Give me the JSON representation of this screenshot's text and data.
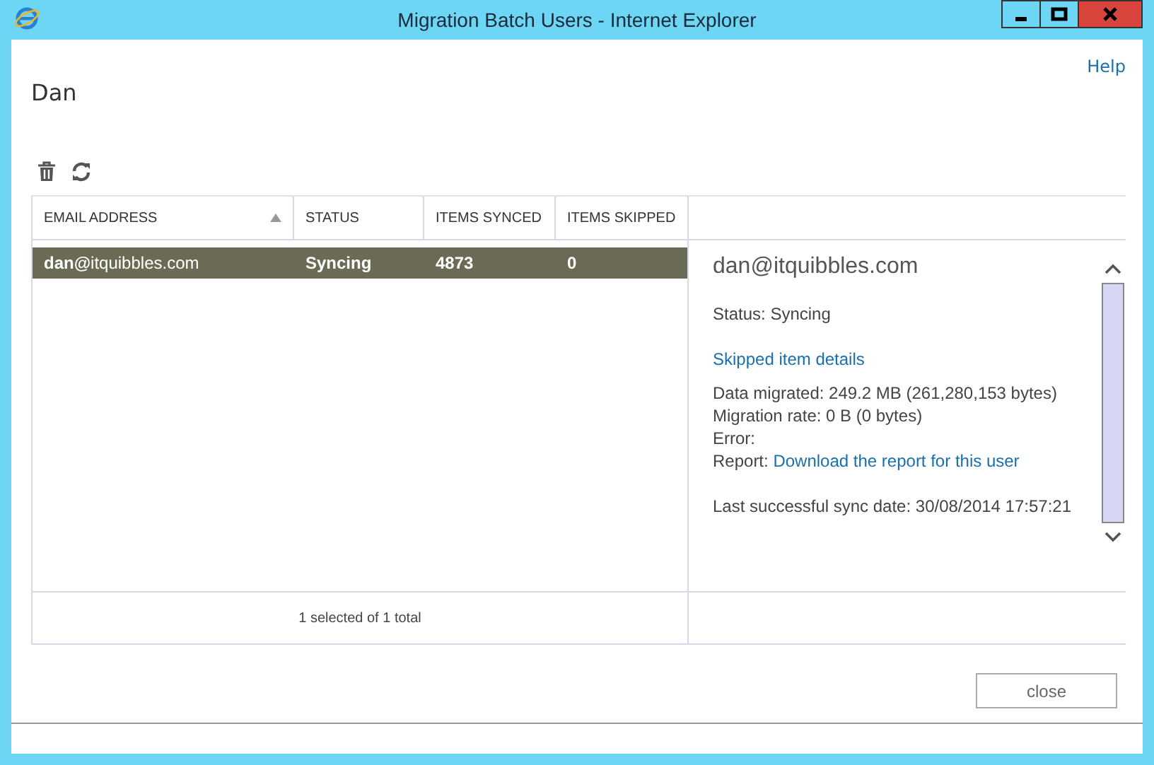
{
  "window": {
    "title": "Migration Batch Users - Internet Explorer"
  },
  "help_link": "Help",
  "page_title": "Dan",
  "table": {
    "columns": [
      {
        "label": "EMAIL ADDRESS",
        "sorted": true
      },
      {
        "label": "STATUS",
        "sorted": false
      },
      {
        "label": "ITEMS SYNCED",
        "sorted": false
      },
      {
        "label": "ITEMS SKIPPED",
        "sorted": false
      }
    ],
    "rows": [
      {
        "selected": true,
        "cells": [
          "**dan@**itquibbles.com",
          "Syncing",
          "4873",
          "0"
        ]
      }
    ],
    "footer": "1 selected of 1 total"
  },
  "details": {
    "title": "dan@itquibbles.com",
    "groups": [
      [
        {
          "kind": "text",
          "text": "Status: Syncing"
        }
      ],
      [
        {
          "kind": "link",
          "text": "Skipped item details"
        }
      ],
      [
        {
          "kind": "text",
          "text": "Data migrated: 249.2 MB (261,280,153 bytes)"
        },
        {
          "kind": "text",
          "text": "Migration rate: 0 B (0 bytes)"
        },
        {
          "kind": "text",
          "text": "Error:"
        },
        {
          "kind": "labeled_link",
          "label": "Report:",
          "text": "Download the report for this user"
        }
      ],
      [
        {
          "kind": "text",
          "text": "Last successful sync date: 30/08/2014 17:57:21"
        }
      ]
    ]
  },
  "buttons": [
    "close"
  ]
}
